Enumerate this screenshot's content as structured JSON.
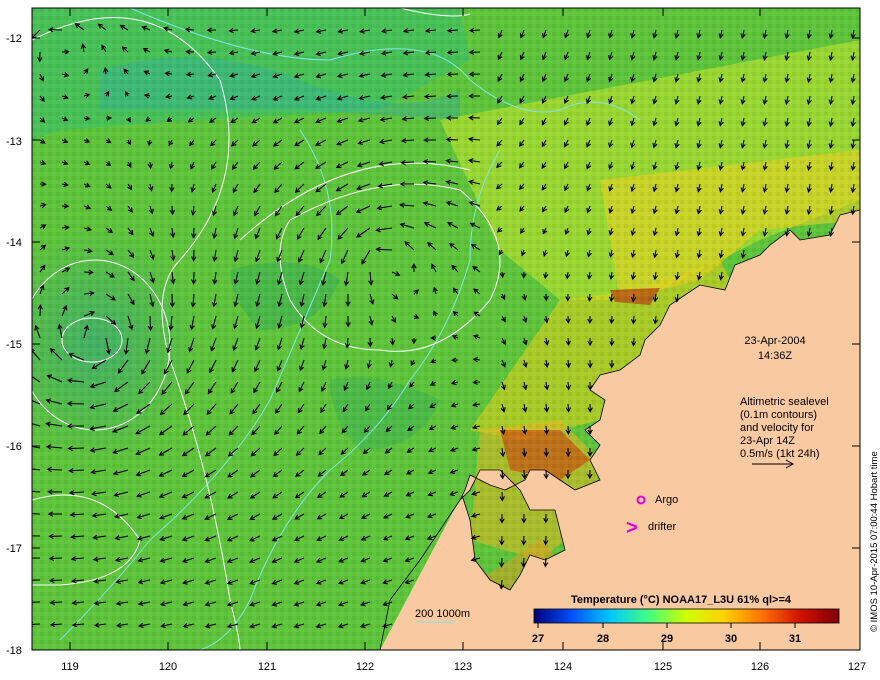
{
  "map": {
    "date": "23-Apr-2004",
    "time": "14:36Z",
    "legend_note_lines": [
      "Altimetric sealevel",
      "(0.1m contours)",
      "and velocity for",
      "23-Apr 14Z",
      "0.5m/s (1kt 24h)"
    ],
    "argo_label": "Argo",
    "drifter_label": "drifter",
    "drifter_symbol": ">",
    "isobath_label": "200  1000m",
    "credit": "© IMOS 10-Apr-2015 07:00:44 Hobart time",
    "colorbar": {
      "title": "Temperature (°C) NOAA17_L3U 61% ql>=4",
      "ticks": [
        "27",
        "28",
        "29",
        "30",
        "31"
      ],
      "range": [
        27,
        31.7
      ],
      "colors": [
        "#00007a",
        "#0050ff",
        "#00c8ff",
        "#40ff80",
        "#d0ff00",
        "#ffd000",
        "#ff7000",
        "#d01000",
        "#800000"
      ]
    },
    "x_ticks": [
      "119",
      "120",
      "121",
      "122",
      "123",
      "124",
      "125",
      "126",
      "127"
    ],
    "y_ticks": [
      "-12",
      "-13",
      "-14",
      "-15",
      "-16",
      "-17",
      "-18"
    ],
    "x_range": [
      118.6,
      127
    ],
    "y_range": [
      -18,
      -11.8
    ],
    "colors": {
      "land": "#f9c9a1",
      "ocean_base": "#5ec43a",
      "argo": "#e000e0",
      "drifter": "#e000e0",
      "isobath": "#7fe6e6",
      "contour": "#ffffff"
    }
  }
}
